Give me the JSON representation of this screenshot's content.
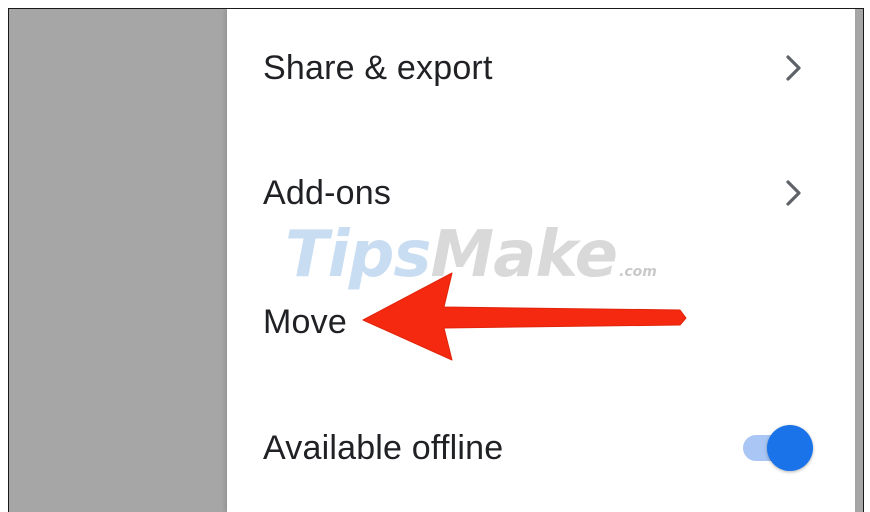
{
  "menu": {
    "items": [
      {
        "label": "Share & export",
        "trailing": "chevron-right"
      },
      {
        "label": "Add-ons",
        "trailing": "chevron-right"
      },
      {
        "label": "Move",
        "trailing": "none"
      },
      {
        "label": "Available offline",
        "trailing": "toggle",
        "toggle_on": true
      }
    ]
  },
  "watermark": {
    "main": "TipsMake",
    "suffix": ".com"
  },
  "colors": {
    "overlay": "#a6a6a6",
    "panel": "#ffffff",
    "text": "#202124",
    "chevron": "#5f6368",
    "toggle_knob": "#1a73e8",
    "toggle_track": "#a9c6f4",
    "annotation_arrow": "#f4290f"
  },
  "annotation": {
    "type": "arrow",
    "points_to": "Move"
  }
}
